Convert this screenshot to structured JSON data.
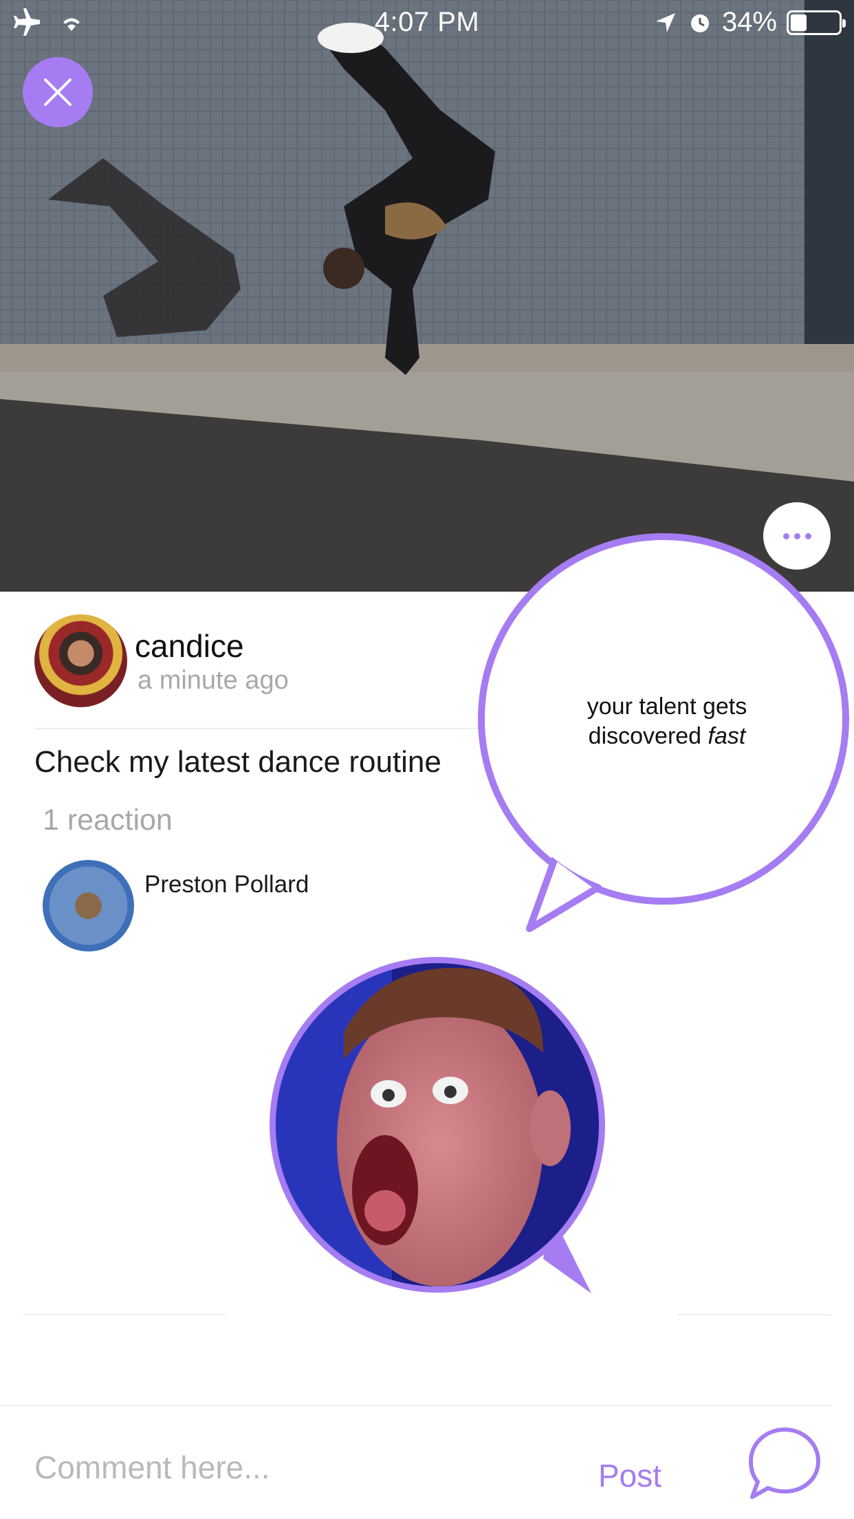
{
  "status_bar": {
    "time": "4:07 PM",
    "battery_text": "34%",
    "battery_level": 0.34,
    "icons": [
      "airplane-icon",
      "wifi-icon",
      "location-arrow-icon",
      "alarm-icon",
      "battery-icon"
    ]
  },
  "controls": {
    "close_icon": "close-icon",
    "more_icon": "more-icon"
  },
  "post": {
    "username": "candice",
    "timestamp": "a minute ago",
    "caption": "Check my latest dance routine",
    "reactions_count": "1 reaction",
    "reactions": [
      {
        "name": "Preston Pollard"
      }
    ]
  },
  "callout": {
    "line1": "your talent gets",
    "line2_prefix": "discovered ",
    "line2_emphasis": "fast"
  },
  "comment": {
    "placeholder": "Comment here...",
    "post_label": "Post",
    "chat_icon": "chat-bubble-icon"
  },
  "colors": {
    "accent": "#a57cf2",
    "muted_text": "#a8a8a8"
  }
}
